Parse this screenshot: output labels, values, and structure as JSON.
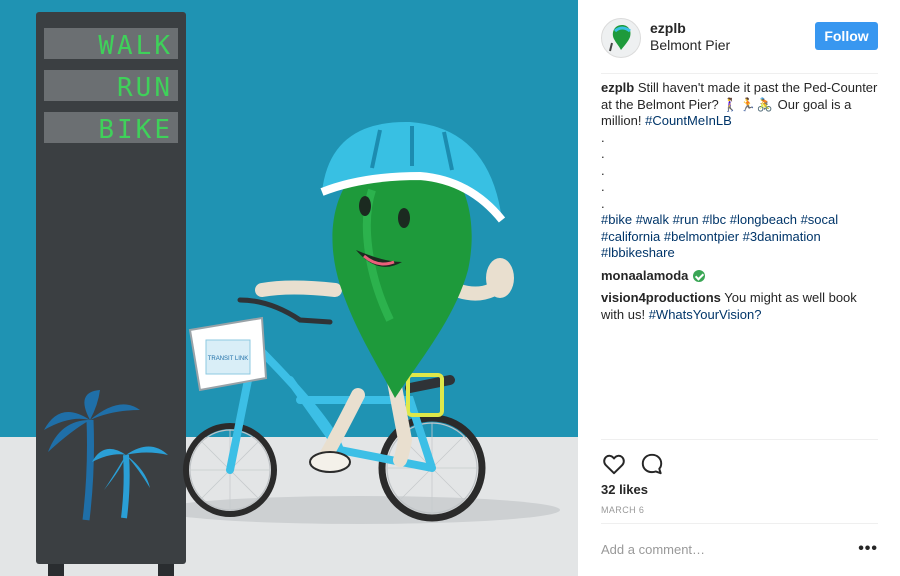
{
  "photo": {
    "counter_rows": [
      "WALK",
      "RUN",
      "BIKE"
    ],
    "basket_text": "TRANSIT LINK",
    "colors": {
      "sky": "#1f93b3",
      "floor": "#e3e5e6",
      "sign": "#3b3f42",
      "character": "#1e9a3b",
      "helmet": "#38c0e3",
      "bike": "#3cbfe6",
      "led": "#3fd15a"
    }
  },
  "header": {
    "username": "ezplb",
    "location": "Belmont Pier",
    "follow_label": "Follow",
    "colors": {
      "follow": "#3897f0"
    }
  },
  "caption": {
    "username": "ezplb",
    "text": "Still haven't made it past the Ped-Counter at the Belmont Pier?",
    "emojis": "🚶‍♀️🏃🚴",
    "text2": "Our goal is a million!",
    "tag1": "#CountMeInLB",
    "dots": [
      ".",
      ".",
      ".",
      ".",
      "."
    ],
    "hashtags": [
      "#bike",
      "#walk",
      "#run",
      "#lbc",
      "#longbeach",
      "#socal",
      "#california",
      "#belmontpier",
      "#3danimation",
      "#lbbikeshare"
    ]
  },
  "comments": [
    {
      "username": "monaalamoda",
      "text": "",
      "emoji": "check-mark-icon"
    },
    {
      "username": "vision4productions",
      "text": "You might as well book with us!",
      "tag": "#WhatsYourVision?"
    }
  ],
  "actions": {
    "like_icon": "heart-icon",
    "comment_icon": "comment-icon"
  },
  "likes": "32 likes",
  "date": "MARCH 6",
  "add_comment": {
    "placeholder": "Add a comment…"
  },
  "more_label": "•••"
}
